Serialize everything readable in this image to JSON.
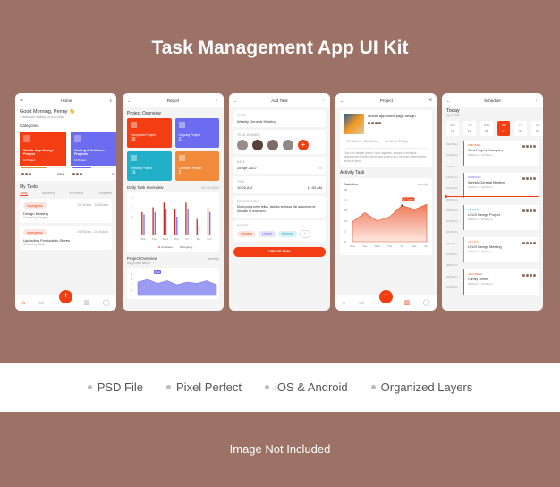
{
  "title": "Task Management App UI Kit",
  "features": [
    "PSD File",
    "Pixel Perfect",
    "iOS & Android",
    "Organized Layers"
  ],
  "footer": "Image Not Included",
  "colors": {
    "background": "#9d7266",
    "accent": "#f23e12",
    "purple": "#6c6cf0",
    "teal": "#22b0c9",
    "orange": "#f28a3c"
  },
  "home": {
    "header": "Home",
    "greeting": "Good Morning, Penny 👋",
    "subtitle": "9 tasks are waiting for you today",
    "categories_label": "Categories",
    "categories": [
      {
        "name": "Mobile App Design Project",
        "projects": "10 Project",
        "meta": "May 12",
        "progress": "58%",
        "progress_value": 58
      },
      {
        "name": "Coding & Software Projects",
        "projects": "10 Project",
        "meta": "Ma",
        "progress": "43",
        "progress_value": 43
      }
    ],
    "my_tasks": "My Tasks",
    "tabs": [
      "Today",
      "Upcoming",
      "In Process",
      "Completed"
    ],
    "tasks": [
      {
        "status": "In progress",
        "time": "09:30am - 11:00am",
        "title": "Design Meeting",
        "by": "Created by Douglas"
      },
      {
        "status": "In progress",
        "time": "01:00pm - 03:00pm",
        "title": "Uploading Products to Stores",
        "by": "Created by Molly"
      }
    ]
  },
  "report": {
    "header": "Report",
    "overview": "Project Overview",
    "stats": [
      {
        "label": "Completed Project",
        "value": "38"
      },
      {
        "label": "Ongoing Project",
        "value": "21"
      },
      {
        "label": "Pending Project",
        "value": "16"
      },
      {
        "label": "Canceled Project",
        "value": "2"
      }
    ],
    "daily": "Daily Task Overview",
    "date": "22.04.2022",
    "project_overview": "Project Overview",
    "period": "weekly",
    "avg": "Avg project daily 3",
    "tooltip": "Wed"
  },
  "addtask": {
    "header": "Add Task",
    "title_label": "TITLE",
    "title_value": "Weekly General Meeting",
    "team_label": "TEAM MEMBER",
    "date_label": "DATE",
    "date_value": "28 Apr 2022",
    "time_label": "TIME",
    "time_start": "10:00 AM",
    "time_end": "11:30 AM",
    "desc_label": "DESCRIPTION",
    "desc_value": "Morbi porta tortor tellus, facilisis vehicula nisi accumsan et. Aliquam id urna nunc.",
    "board_label": "BOARD",
    "boards": [
      "Ongoing",
      "Urgent",
      "Working"
    ],
    "button": "CREATE TASK"
  },
  "project": {
    "header": "Project",
    "name": "Mobile app home page design",
    "time": "09:30am - 11:00am",
    "date": "Wed, 24 Apr",
    "desc": "Cras non aliquet ipsum. Nunc egestas, massa eu tristique ullamcorper facilisis, elit massa viverra orci, sit amet eleifend sem lectus et enim.",
    "activity": "Activity Task",
    "stats": "Statistics",
    "period": "weekly",
    "tooltip": "15 Tasks"
  },
  "schedule": {
    "header": "Schedule",
    "today": "Today",
    "month": "April 2022",
    "days": [
      {
        "d": "Mon",
        "n": "18"
      },
      {
        "d": "Tue",
        "n": "19"
      },
      {
        "d": "Wed",
        "n": "20"
      },
      {
        "d": "Thu",
        "n": "21",
        "active": true
      },
      {
        "d": "Fri",
        "n": "22"
      },
      {
        "d": "Sat",
        "n": "23"
      }
    ],
    "times": [
      "09:00 am",
      "10:00 am",
      "11:00 am",
      "12:00 pm",
      "01:00 pm",
      "02:00 pm",
      "03:00 pm",
      "04:00 pm",
      "05:00 pm",
      "06:00 pm",
      "07:00 pm",
      "08:00 pm",
      "09:00 pm",
      "10:00 pm"
    ],
    "events": [
      {
        "tag": "ONGOING",
        "title": "View Project Examples",
        "time": "09:00 am - 11:00 am",
        "color": "#e2532b"
      },
      {
        "tag": "WORKING",
        "title": "Weekly General Meeting",
        "time": "12:00 pm - 02:00 pm",
        "color": "#6c6cf0"
      },
      {
        "tag": "PENDING",
        "title": "UI/UX Design Project",
        "time": "03:00 pm - 05:00 pm",
        "color": "#22b0c9"
      },
      {
        "tag": "URGENT",
        "title": "UI/UX Design Meeting",
        "time": "06:00 pm - 08:00 pm",
        "color": "#f28a3c"
      },
      {
        "tag": "UPCOMING",
        "title": "Family Dinner",
        "time": "09:00 pm - 11:00 pm",
        "color": "#e2532b"
      }
    ]
  },
  "chart_data": [
    {
      "type": "bar",
      "title": "Daily Task Overview",
      "categories": [
        "Mon",
        "Tue",
        "Wed",
        "Thu",
        "Fri",
        "Sat",
        "Sun"
      ],
      "ylim": [
        0,
        8
      ],
      "yticks": [
        0,
        2,
        4,
        6,
        8
      ],
      "series": [
        {
          "name": "Complete",
          "values": [
            5,
            6,
            7,
            5.5,
            7,
            3.5,
            6
          ]
        },
        {
          "name": "Ongoing",
          "values": [
            4.5,
            5,
            5.5,
            4,
            5.5,
            2,
            5
          ]
        }
      ],
      "legend": "bottom"
    },
    {
      "type": "area",
      "title": "Statistics",
      "categories": [
        "Mon",
        "Tue",
        "Wed",
        "Thu",
        "Fri",
        "Sat",
        "Sun"
      ],
      "ylim": [
        0,
        25
      ],
      "yticks": [
        0,
        5,
        10,
        15,
        20,
        25
      ],
      "values": [
        9.5,
        14,
        10,
        12,
        17.5,
        15.5,
        18
      ]
    },
    {
      "type": "area",
      "title": "Project Overview",
      "yticks": [
        2,
        4,
        6,
        8
      ],
      "ylim": [
        0,
        9
      ],
      "values": [
        5,
        6,
        4.5,
        5.5,
        4,
        5,
        4.5,
        5.5,
        4
      ]
    }
  ]
}
